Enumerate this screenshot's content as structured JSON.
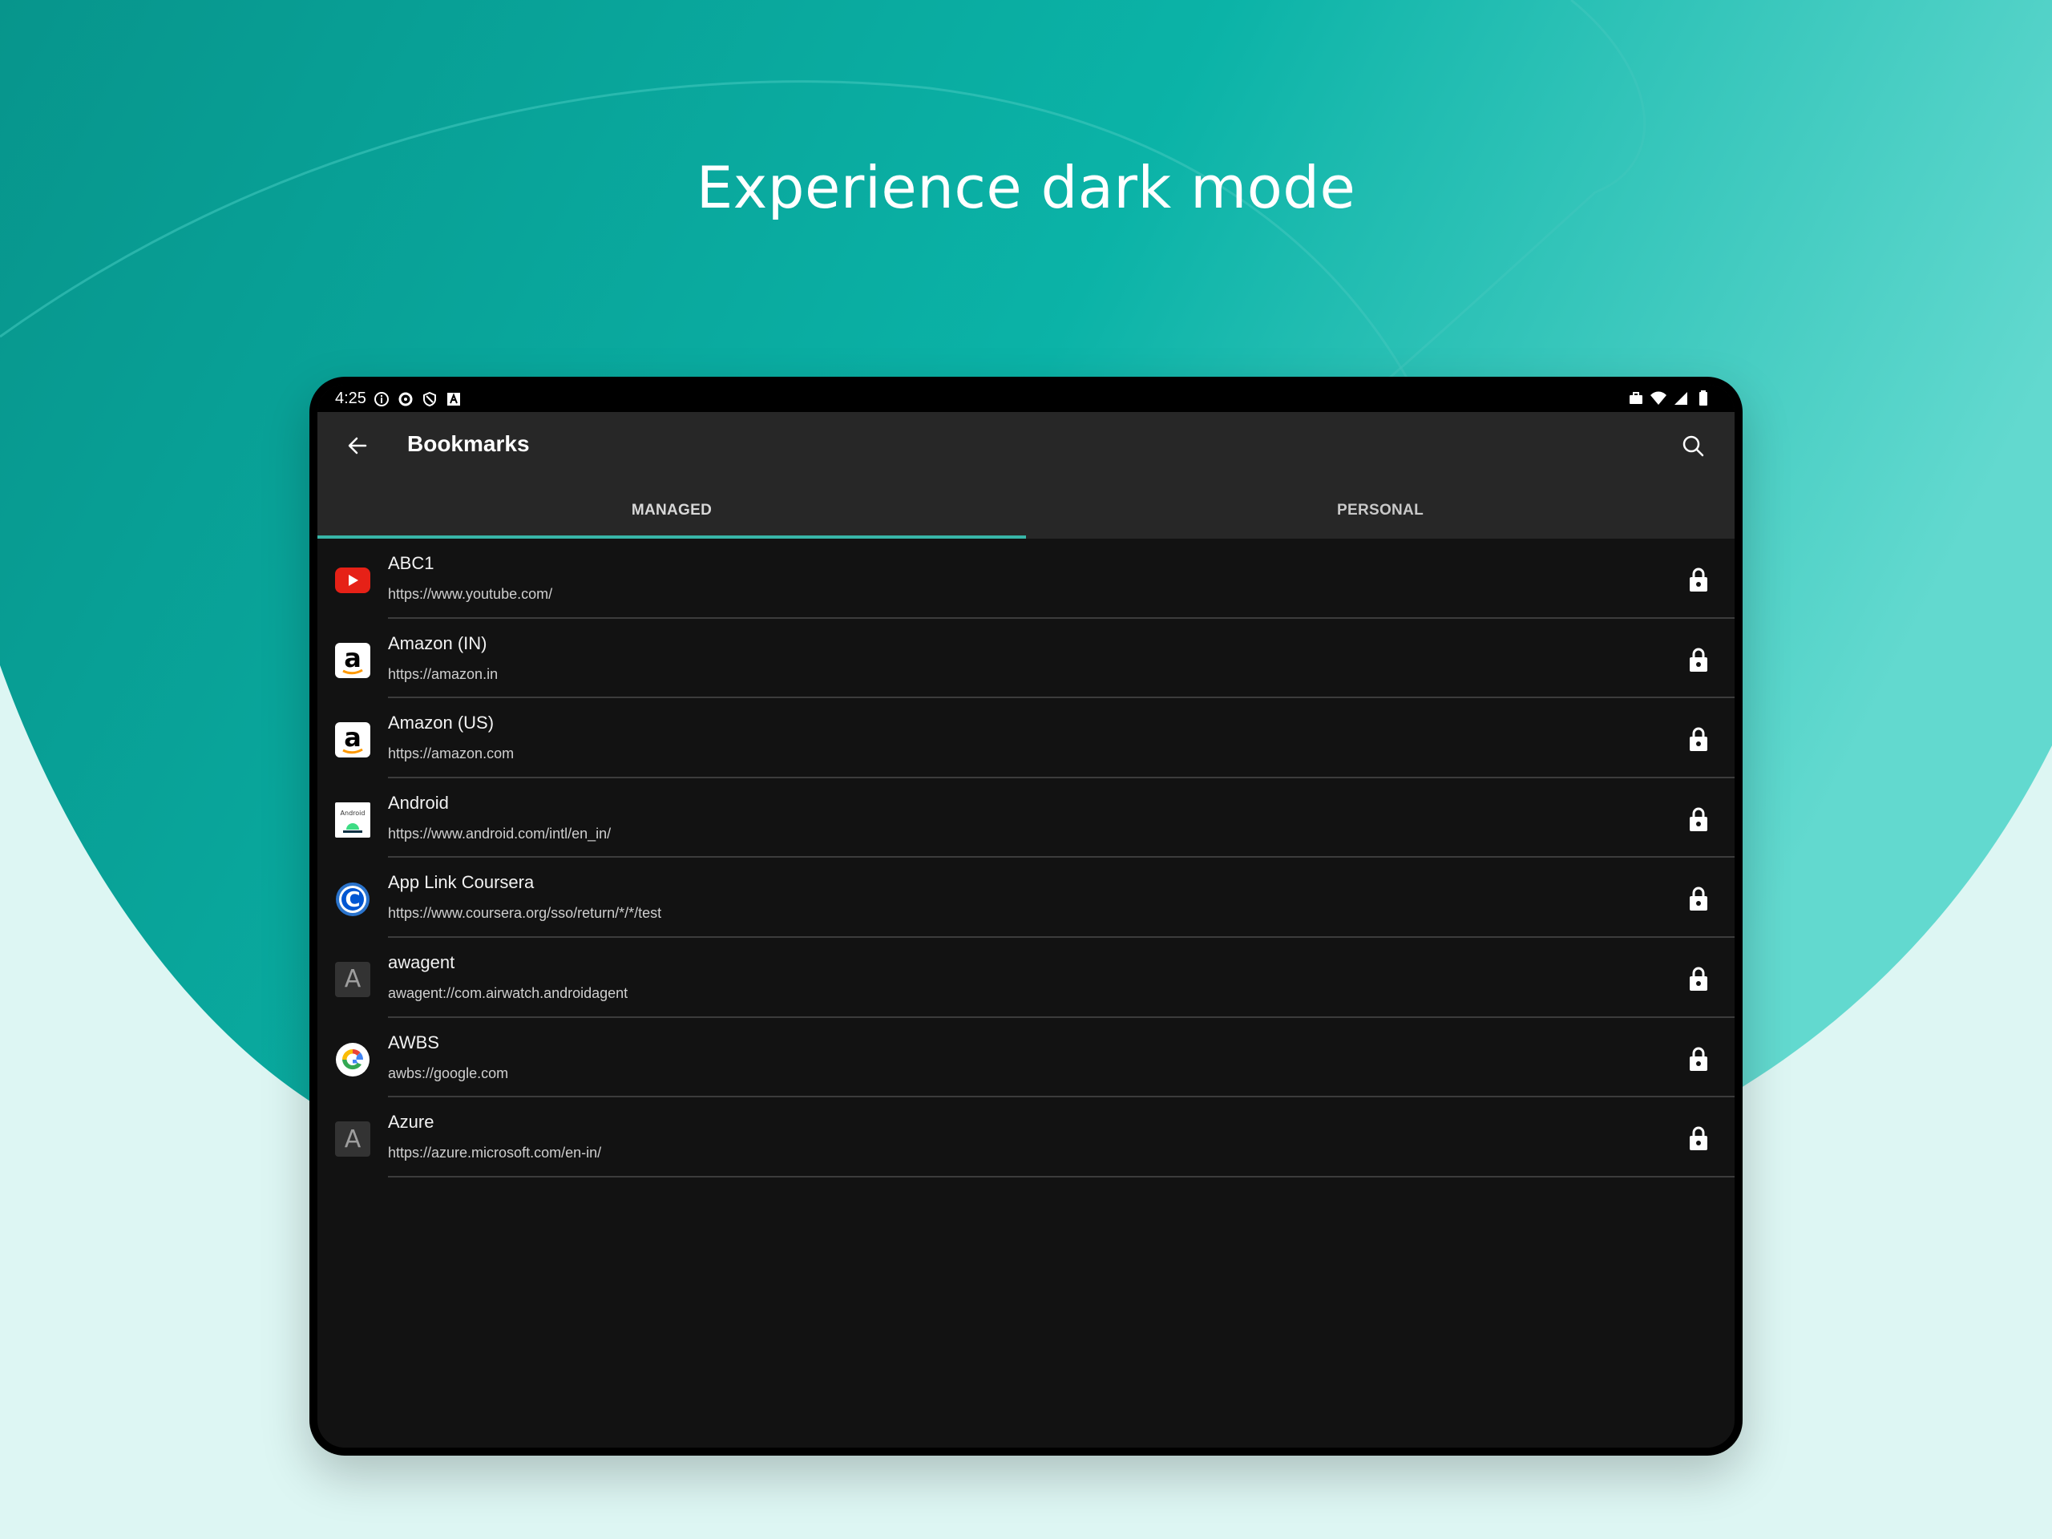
{
  "headline": "Experience dark mode",
  "colors": {
    "background_light": "#ddf6f3",
    "teal_accent": "#0bb3a7",
    "tab_indicator": "#38b6a8",
    "app_bar": "#272727",
    "list_bg": "#121212"
  },
  "status_bar": {
    "time": "4:25",
    "left_icons": [
      "info-icon",
      "vpn-icon",
      "shield-icon",
      "a-notification-icon"
    ],
    "right_icons": [
      "briefcase-icon",
      "wifi-icon",
      "signal-icon",
      "battery-icon"
    ]
  },
  "app_bar": {
    "title": "Bookmarks",
    "back_icon": "arrow-back-icon",
    "search_icon": "search-icon"
  },
  "tabs": [
    {
      "label": "MANAGED",
      "active": true
    },
    {
      "label": "PERSONAL",
      "active": false
    }
  ],
  "bookmarks": [
    {
      "name": "ABC1",
      "url": "https://www.youtube.com/",
      "icon": "youtube-icon",
      "locked": true
    },
    {
      "name": "Amazon (IN)",
      "url": "https://amazon.in",
      "icon": "amazon-icon",
      "locked": true
    },
    {
      "name": "Amazon (US)",
      "url": "https://amazon.com",
      "icon": "amazon-icon",
      "locked": true
    },
    {
      "name": "Android",
      "url": "https://www.android.com/intl/en_in/",
      "icon": "android-icon",
      "locked": true
    },
    {
      "name": "App Link Coursera",
      "url": "https://www.coursera.org/sso/return/*/*/test",
      "icon": "coursera-icon",
      "locked": true
    },
    {
      "name": "awagent",
      "url": "awagent://com.airwatch.androidagent",
      "icon": "letter-icon",
      "letter": "A",
      "locked": true
    },
    {
      "name": "AWBS",
      "url": "awbs://google.com",
      "icon": "google-icon",
      "locked": true
    },
    {
      "name": "Azure",
      "url": "https://azure.microsoft.com/en-in/",
      "icon": "letter-icon",
      "letter": "A",
      "locked": true
    }
  ],
  "icon_labels": {
    "amazon_letter": "a",
    "android_text": "Android",
    "coursera_letter": "C"
  }
}
